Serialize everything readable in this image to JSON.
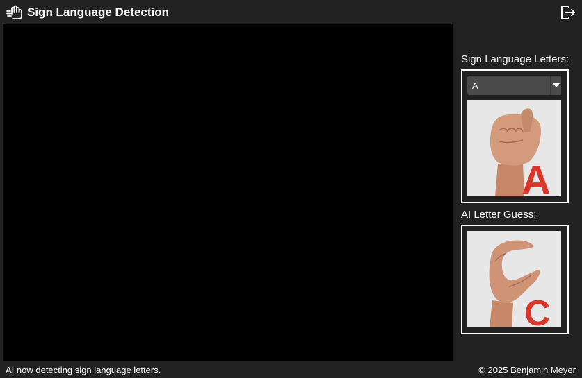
{
  "header": {
    "title": "Sign Language Detection",
    "app_icon": "hand-sign-icon",
    "logout_icon": "logout-icon"
  },
  "sidebar": {
    "letters_label": "Sign Language Letters:",
    "letter_select": {
      "selected": "A"
    },
    "letter_image_letter": "A",
    "guess_label": "AI Letter Guess:",
    "guess_image_letter": "C"
  },
  "footer": {
    "status": "AI now detecting sign language letters.",
    "copyright": "© 2025 Benjamin Meyer"
  },
  "colors": {
    "background": "#222222",
    "camera": "#000000",
    "panel_border": "#ffffff",
    "letter_red": "#d9352b"
  }
}
